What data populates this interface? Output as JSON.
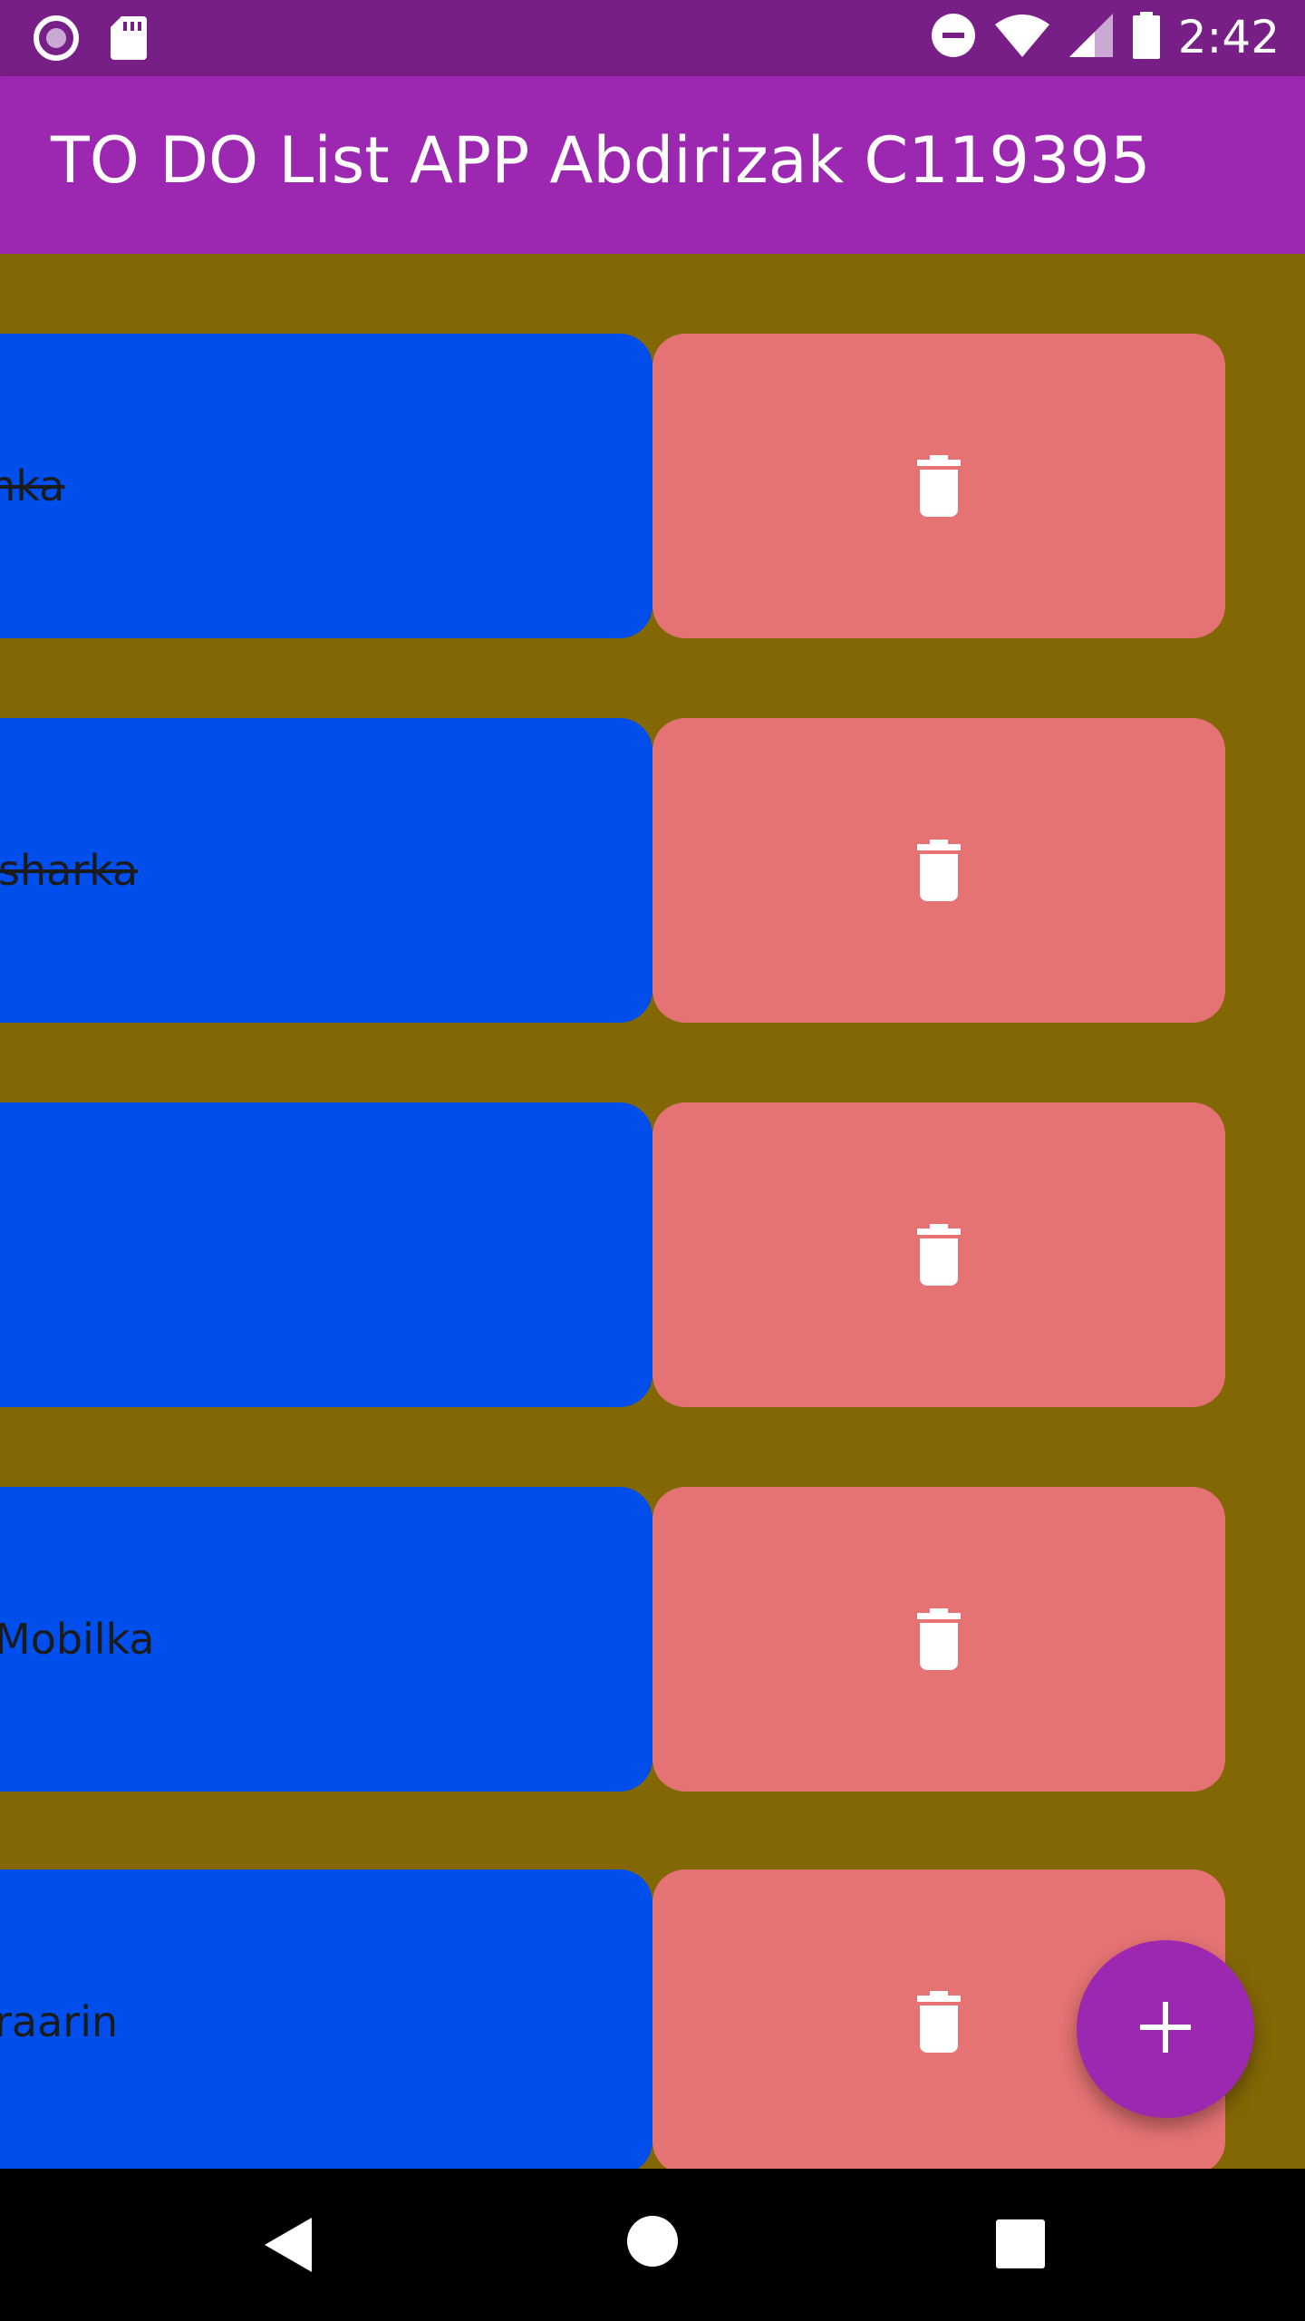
{
  "status_bar": {
    "time": "2:42",
    "left_icons": [
      "record-icon",
      "sd-card-icon"
    ],
    "right_icons": [
      "do-not-disturb-icon",
      "wifi-icon",
      "cell-signal-icon",
      "battery-icon"
    ]
  },
  "app_bar": {
    "title": "TO DO List APP Abdirizak C119395",
    "color": "#9C27B0"
  },
  "tasks": [
    {
      "text": "anka",
      "done": true
    },
    {
      "text": "sharka",
      "done": true
    },
    {
      "text": "",
      "done": false
    },
    {
      "text": "Mobilka",
      "done": false
    },
    {
      "text": "raarin",
      "done": false
    }
  ],
  "colors": {
    "background": "#846705",
    "task_card": "#004FEC",
    "delete_card": "#E57373",
    "fab": "#9C27B0"
  },
  "icons": {
    "delete": "trash-icon",
    "fab": "plus-icon",
    "nav": [
      "back-icon",
      "home-icon",
      "recents-icon"
    ]
  }
}
